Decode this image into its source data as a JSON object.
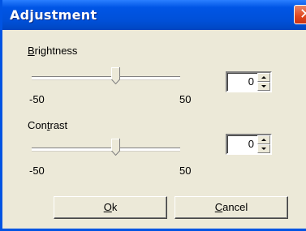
{
  "window": {
    "title": "Adjustment"
  },
  "brightness": {
    "label_accel": "B",
    "label_rest": "rightness",
    "min_label": "-50",
    "max_label": "50",
    "value": "0",
    "slider_fraction": 0.55
  },
  "contrast": {
    "label_pre": "Con",
    "label_accel": "t",
    "label_rest": "rast",
    "min_label": "-50",
    "max_label": "50",
    "value": "0",
    "slider_fraction": 0.55
  },
  "buttons": {
    "ok_accel": "O",
    "ok_rest": "k",
    "cancel_accel": "C",
    "cancel_rest": "ancel"
  },
  "colors": {
    "title_bar": "#0054e3",
    "close": "#e0471f",
    "face": "#ece9d8"
  },
  "icons": {
    "close": "close-icon",
    "spin_up": "up-arrow-icon",
    "spin_down": "down-arrow-icon"
  }
}
